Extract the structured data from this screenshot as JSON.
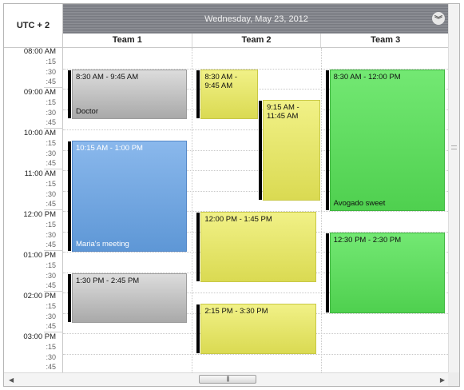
{
  "timezone": "UTC + 2",
  "date_title": "Wednesday, May 23, 2012",
  "teams": [
    "Team 1",
    "Team 2",
    "Team 3"
  ],
  "time_labels": [
    "08:00 AM",
    ":15",
    ":30",
    ":45",
    "09:00 AM",
    ":15",
    ":30",
    ":45",
    "10:00 AM",
    ":15",
    ":30",
    ":45",
    "11:00 AM",
    ":15",
    ":30",
    ":45",
    "12:00 PM",
    ":15",
    ":30",
    ":45",
    "01:00 PM",
    ":15",
    ":30",
    ":45",
    "02:00 PM",
    ":15",
    ":30",
    ":45",
    "03:00 PM",
    ":15",
    ":30",
    ":45"
  ],
  "events": [
    {
      "team": 1,
      "time": "8:30 AM - 9:45 AM",
      "title": "Doctor",
      "color": "gray"
    },
    {
      "team": 1,
      "time": "10:15 AM - 1:00 PM",
      "title": "Maria's meeting",
      "color": "blue"
    },
    {
      "team": 1,
      "time": "1:30 PM - 2:45 PM",
      "title": "",
      "color": "gray"
    },
    {
      "team": 2,
      "time": "8:30 AM - 9:45 AM",
      "title": "",
      "color": "yellow"
    },
    {
      "team": 2,
      "time": "9:15 AM - 11:45 AM",
      "title": "",
      "color": "yellow"
    },
    {
      "team": 2,
      "time": "12:00 PM - 1:45 PM",
      "title": "",
      "color": "yellow"
    },
    {
      "team": 2,
      "time": "2:15 PM - 3:30 PM",
      "title": "",
      "color": "yellow"
    },
    {
      "team": 3,
      "time": "8:30 AM - 12:00 PM",
      "title": "Avogado sweet",
      "color": "green"
    },
    {
      "team": 3,
      "time": "12:30 PM - 2:30 PM",
      "title": "",
      "color": "green"
    }
  ],
  "colors": {
    "gray": "#b9b9b9",
    "blue": "#6fa5e2",
    "yellow": "#e6e66a",
    "green": "#5fdc5f",
    "header": "#808288"
  },
  "icons": {
    "collapse": "double-chevron-down-icon",
    "scroll_left": "arrow-left-icon",
    "scroll_right": "arrow-right-icon",
    "scroll_thumb": "grip-icon"
  }
}
